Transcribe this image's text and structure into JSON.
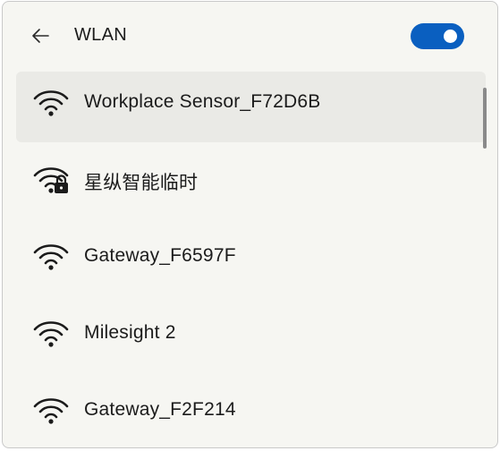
{
  "header": {
    "title": "WLAN",
    "back_icon": "back-arrow-icon",
    "toggle_on": true,
    "toggle_color": "#0a5fc0"
  },
  "networks": [
    {
      "ssid": "Workplace Sensor_F72D6B",
      "secured": false,
      "selected": true
    },
    {
      "ssid": "星纵智能临时",
      "secured": true,
      "selected": false
    },
    {
      "ssid": "Gateway_F6597F",
      "secured": false,
      "selected": false
    },
    {
      "ssid": "Milesight 2",
      "secured": false,
      "selected": false
    },
    {
      "ssid": "Gateway_F2F214",
      "secured": false,
      "selected": false
    }
  ],
  "icons": {
    "wifi": "wifi-icon",
    "lock": "lock-icon"
  }
}
